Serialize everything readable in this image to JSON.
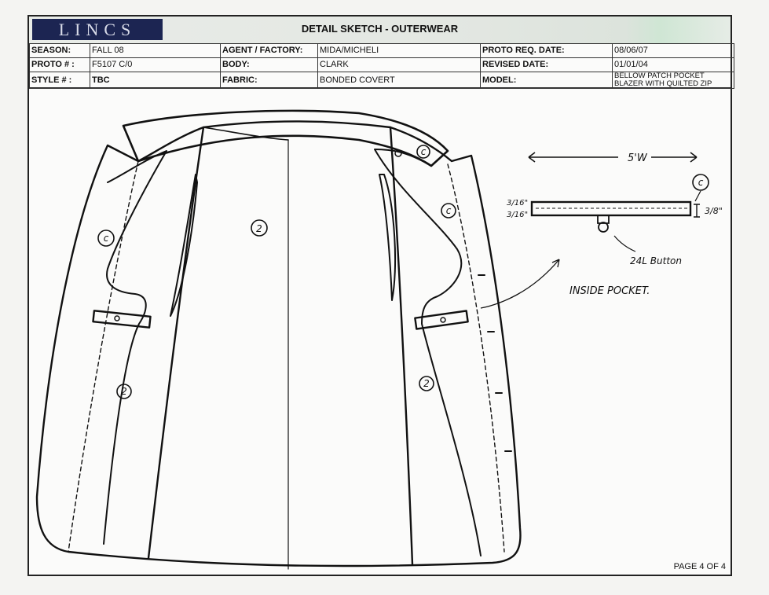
{
  "header": {
    "logo": "LINCS",
    "title": "DETAIL SKETCH - OUTERWEAR"
  },
  "info": {
    "season_label": "SEASON:",
    "season": "FALL 08",
    "proto_label": "PROTO # :",
    "proto": "F5107 C/0",
    "style_label": "STYLE # :",
    "style": "TBC",
    "agent_label": "AGENT / FACTORY:",
    "agent": "MIDA/MICHELI",
    "body_label": "BODY:",
    "body": "CLARK",
    "fabric_label": "FABRIC:",
    "fabric": "BONDED COVERT",
    "proto_date_label": "PROTO REQ. DATE:",
    "proto_date": "08/06/07",
    "revised_label": "REVISED DATE:",
    "revised": "01/01/04",
    "model_label": "MODEL:",
    "model_line1": "BELLOW PATCH POCKET",
    "model_line2": "BLAZER WITH QUILTED ZIP"
  },
  "annotations": {
    "width": "5'W",
    "dim_left_top": "3/16\"",
    "dim_left_bottom": "3/16\"",
    "dim_right": "3/8\"",
    "button": "24L Button",
    "inside_pocket": "INSIDE POCKET.",
    "mark_c": "c",
    "mark_2": "2"
  },
  "footer": {
    "page": "PAGE 4 OF 4"
  }
}
